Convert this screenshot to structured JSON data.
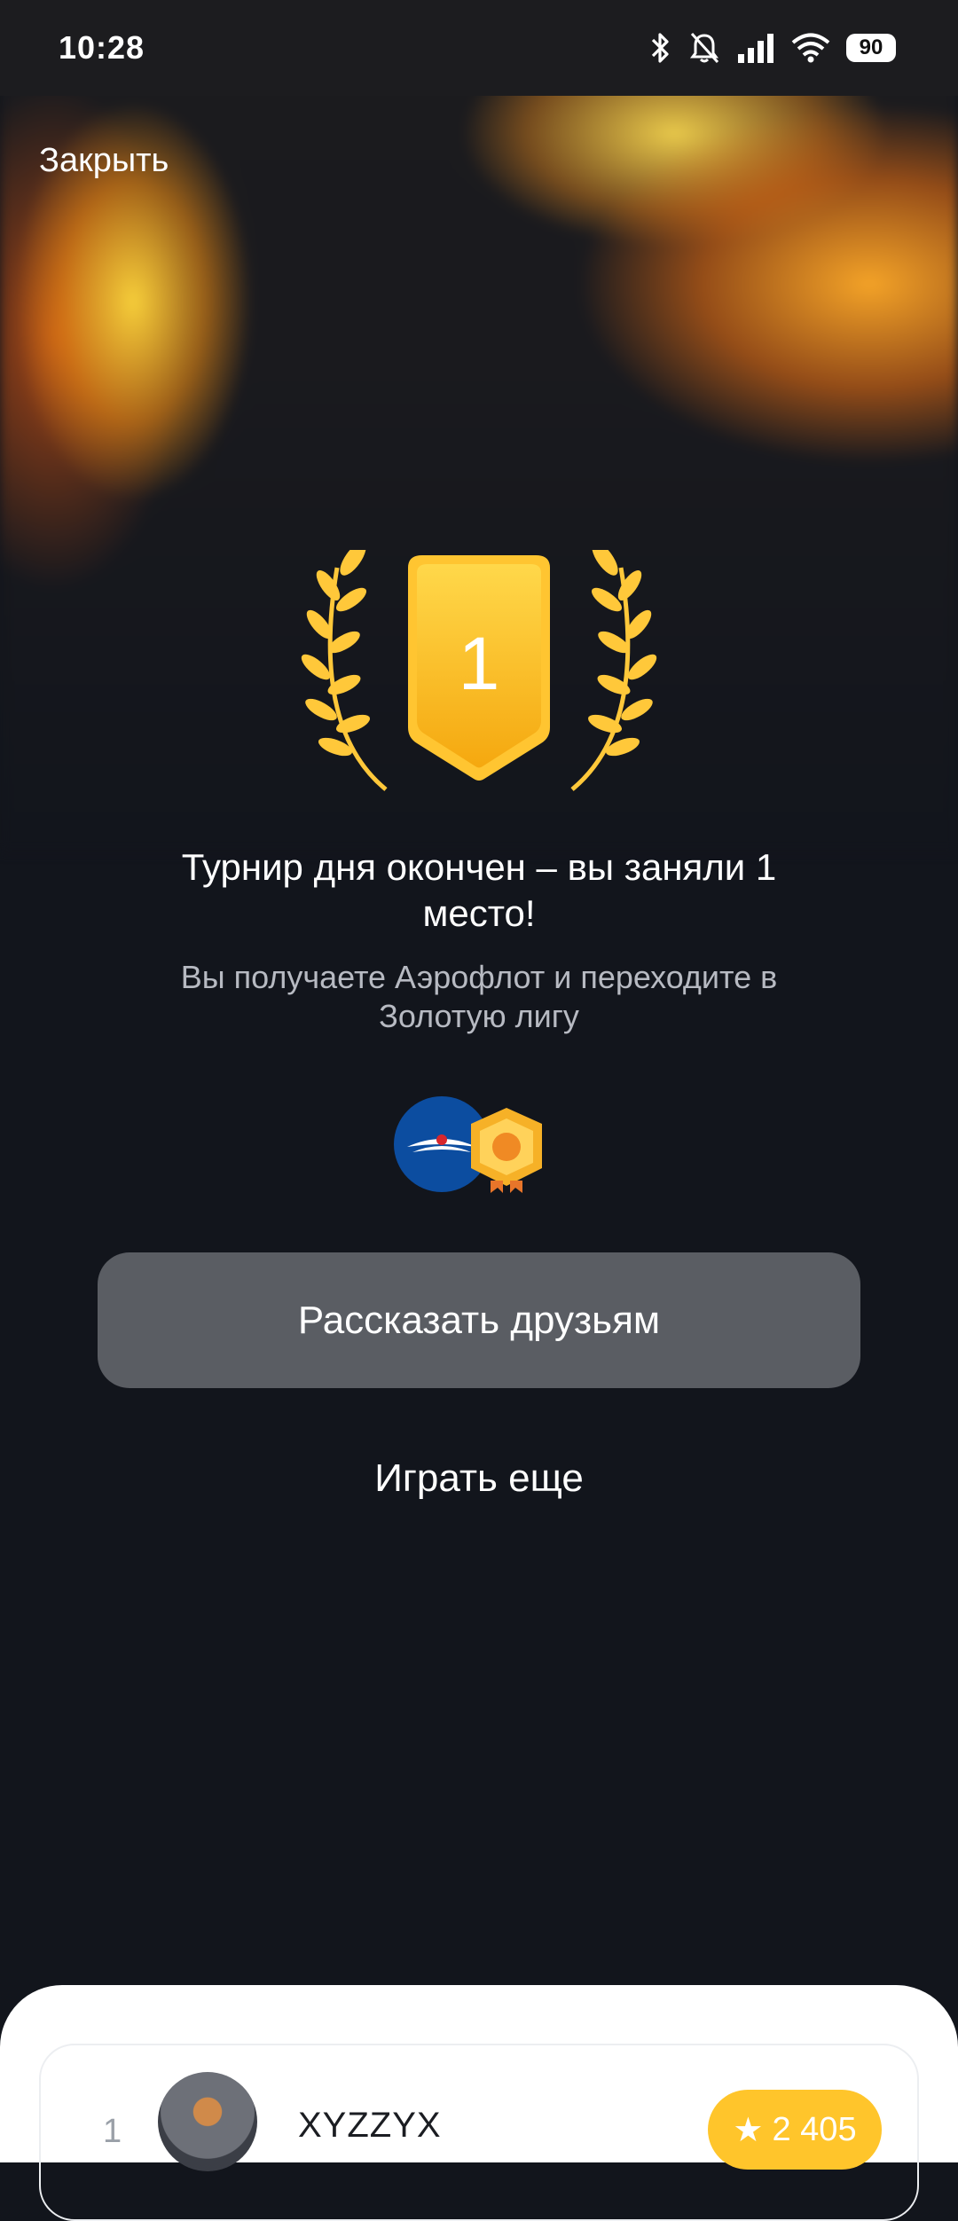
{
  "status_bar": {
    "time": "10:28",
    "battery": "90",
    "icons": [
      "bluetooth-icon",
      "bell-muted-icon",
      "signal-icon",
      "wifi-icon",
      "battery-icon"
    ]
  },
  "header": {
    "close_label": "Закрыть"
  },
  "award": {
    "place": "1"
  },
  "result": {
    "title": "Турнир дня окончен – вы заняли 1 место!",
    "subtitle": "Вы получаете Аэрофлот и переходите в Золотую лигу"
  },
  "rewards": [
    "aeroflot-logo",
    "gold-league-badge"
  ],
  "actions": {
    "share_label": "Рассказать друзьям",
    "play_again_label": "Играть еще"
  },
  "leaderboard": {
    "rows": [
      {
        "rank": "1",
        "name": "XYZZYX",
        "score": "2 405"
      }
    ]
  },
  "colors": {
    "accent": "#ffc52b",
    "background": "#12151c",
    "button": "#5a5d63"
  }
}
